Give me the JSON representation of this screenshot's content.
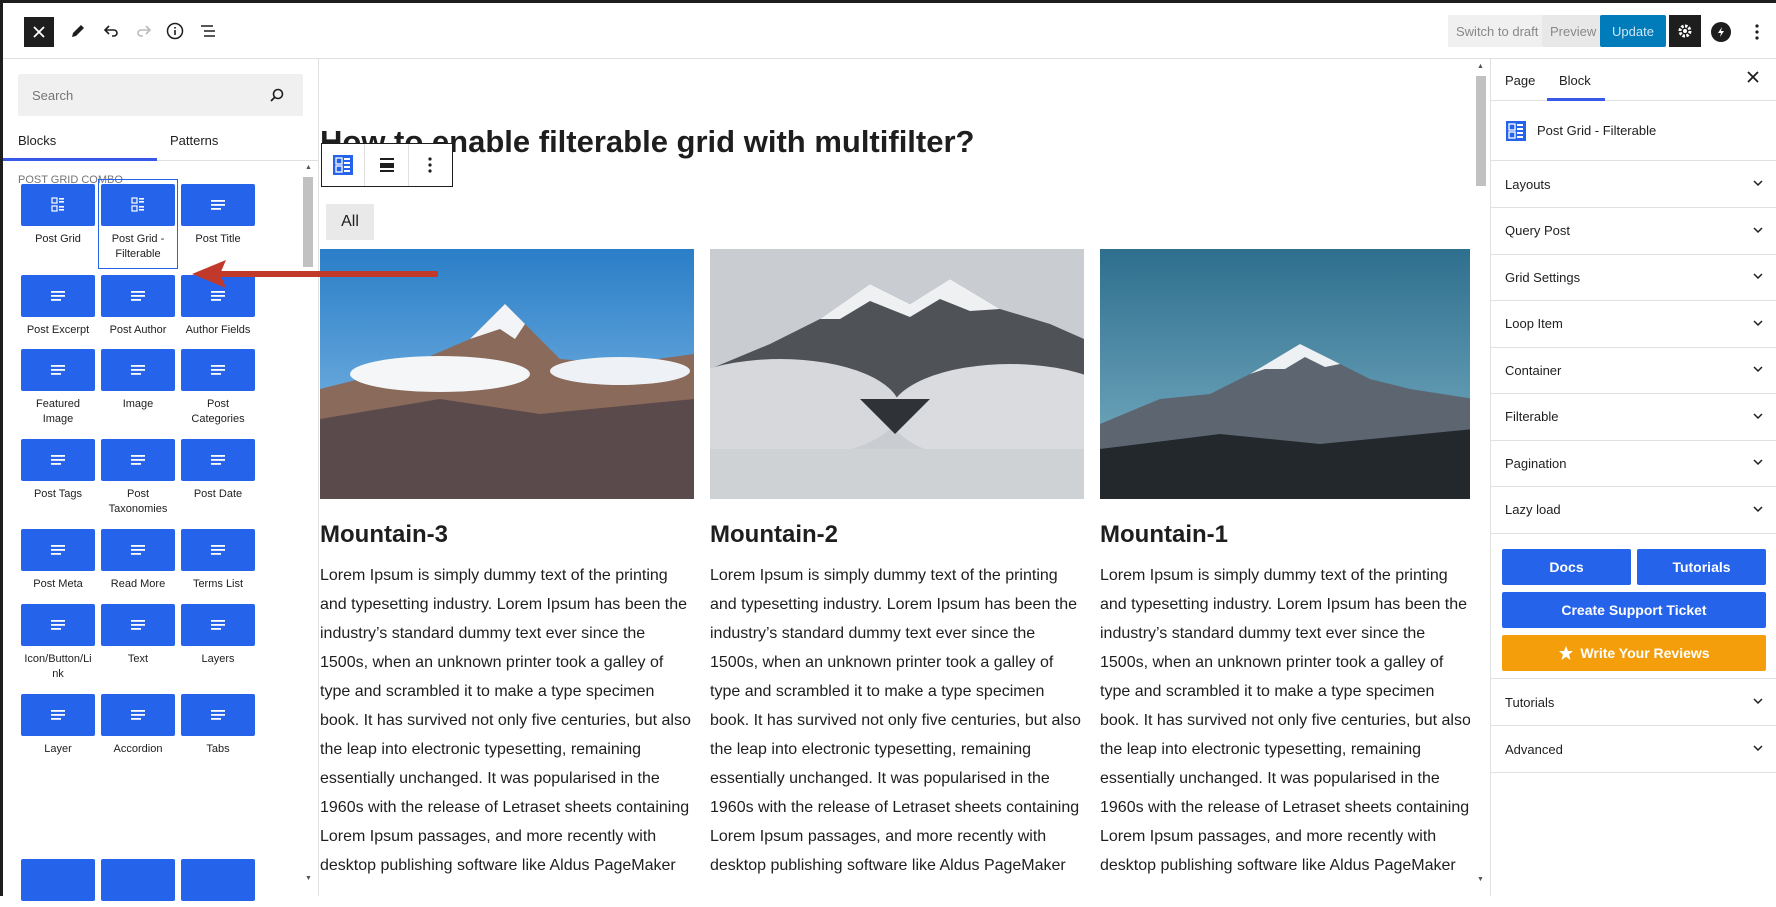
{
  "header": {
    "close_label": "×",
    "switch_draft": "Switch to draft",
    "preview": "Preview",
    "update": "Update"
  },
  "left_sidebar": {
    "search_placeholder": "Search",
    "tab_blocks": "Blocks",
    "tab_patterns": "Patterns",
    "category": "POST GRID COMBO",
    "blocks": [
      {
        "l1": "Post Grid",
        "l2": ""
      },
      {
        "l1": "Post Grid -",
        "l2": "Filterable"
      },
      {
        "l1": "Post Title",
        "l2": ""
      },
      {
        "l1": "Post Excerpt",
        "l2": ""
      },
      {
        "l1": "Post Author",
        "l2": ""
      },
      {
        "l1": "Author Fields",
        "l2": ""
      },
      {
        "l1": "Featured",
        "l2": "Image"
      },
      {
        "l1": "Image",
        "l2": ""
      },
      {
        "l1": "Post",
        "l2": "Categories"
      },
      {
        "l1": "Post Tags",
        "l2": ""
      },
      {
        "l1": "Post",
        "l2": "Taxonomies"
      },
      {
        "l1": "Post Date",
        "l2": ""
      },
      {
        "l1": "Post Meta",
        "l2": ""
      },
      {
        "l1": "Read More",
        "l2": ""
      },
      {
        "l1": "Terms List",
        "l2": ""
      },
      {
        "l1": "Icon/Button/Li",
        "l2": "nk"
      },
      {
        "l1": "Text",
        "l2": ""
      },
      {
        "l1": "Layers",
        "l2": ""
      },
      {
        "l1": "Layer",
        "l2": ""
      },
      {
        "l1": "Accordion",
        "l2": ""
      },
      {
        "l1": "Tabs",
        "l2": ""
      }
    ]
  },
  "canvas": {
    "title": "How to enable filterable grid with multifilter?",
    "filter_all": "All",
    "posts": [
      {
        "title": "Mountain-3"
      },
      {
        "title": "Mountain-2"
      },
      {
        "title": "Mountain-1"
      }
    ],
    "body_lines": [
      "Lorem Ipsum is simply dummy text of the printing",
      "and typesetting industry. Lorem Ipsum has been the",
      "industry’s standard dummy text ever since the",
      "1500s, when an unknown printer took a galley of",
      "type and scrambled it to make a type specimen",
      "book. It has survived not only five centuries, but also",
      "the leap into electronic typesetting, remaining",
      "essentially unchanged. It was popularised in the",
      "1960s with the release of Letraset sheets containing",
      "Lorem Ipsum passages, and more recently with",
      "desktop publishing software like Aldus PageMaker"
    ]
  },
  "right_sidebar": {
    "tab_page": "Page",
    "tab_block": "Block",
    "block_name": "Post Grid - Filterable",
    "panels": [
      "Layouts",
      "Query Post",
      "Grid Settings",
      "Loop Item",
      "Container",
      "Filterable",
      "Pagination",
      "Lazy load"
    ],
    "docs": "Docs",
    "tutorials_btn": "Tutorials",
    "support": "Create Support Ticket",
    "reviews": "Write Your Reviews",
    "panels2": [
      "Tutorials",
      "Advanced"
    ]
  },
  "colors": {
    "accent": "#2563eb",
    "update": "#007cba",
    "review": "#f59e0b",
    "arrow": "#c0392b"
  }
}
